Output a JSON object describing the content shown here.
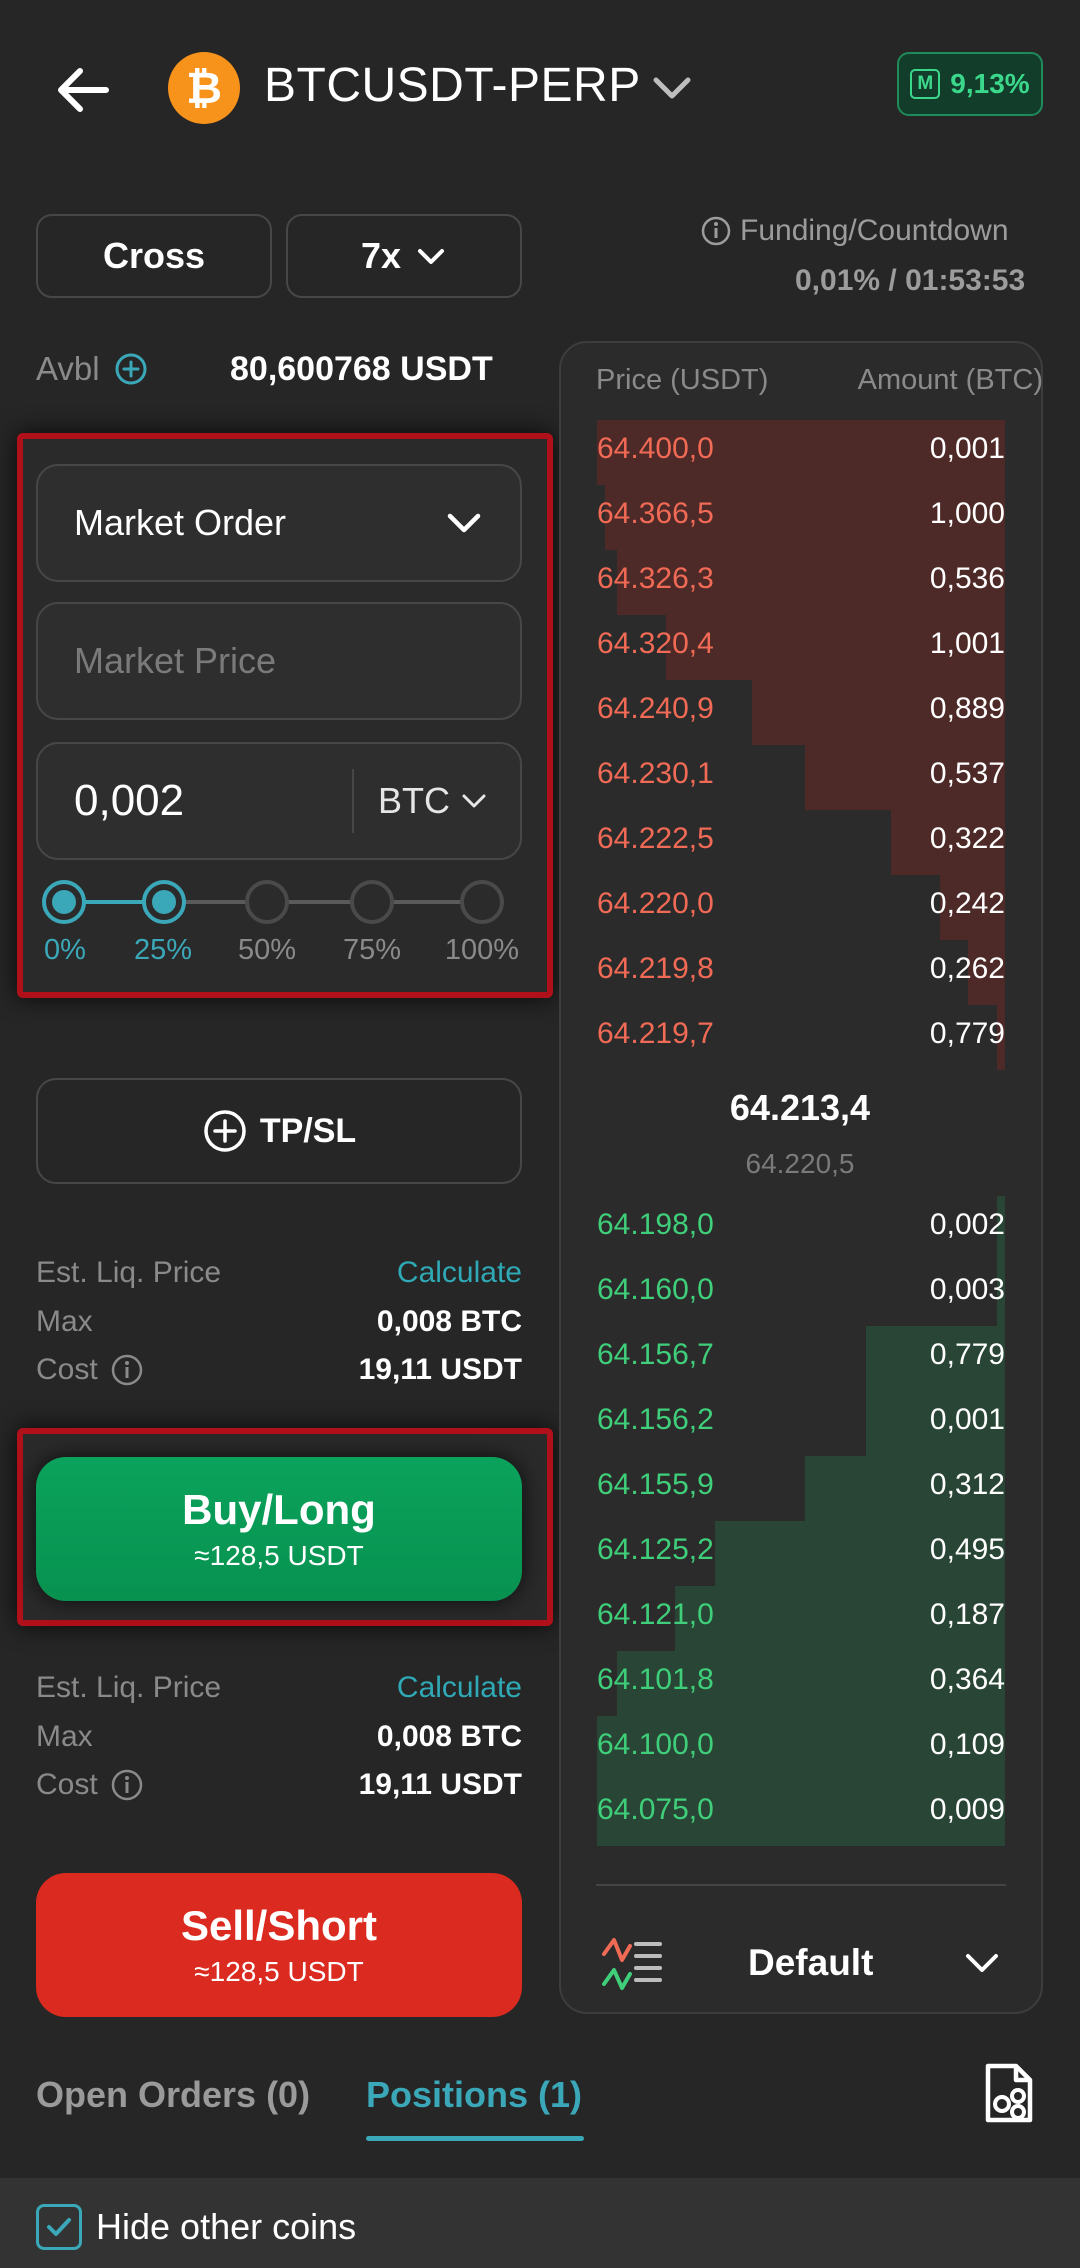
{
  "header": {
    "pair": "BTCUSDT-PERP",
    "coin_icon": "bitcoin-icon",
    "margin_badge_letter": "M",
    "margin_ratio": "9,13%",
    "colors": {
      "badge_green": "#3bd88c",
      "accent": "#3aa8b8"
    }
  },
  "controls": {
    "margin_mode": "Cross",
    "leverage": "7x",
    "funding_label": "Funding/Countdown",
    "funding_value": "0,01% / 01:53:53"
  },
  "balance": {
    "label": "Avbl",
    "value": "80,600768 USDT"
  },
  "order_form": {
    "order_type": "Market Order",
    "price_placeholder": "Market Price",
    "quantity": "0,002",
    "quantity_unit": "BTC",
    "slider": {
      "value_percent": 25,
      "marks": [
        "0%",
        "25%",
        "50%",
        "75%",
        "100%"
      ]
    },
    "tpsl_label": "TP/SL"
  },
  "buy_info": {
    "liq_label": "Est. Liq. Price",
    "liq_action": "Calculate",
    "max_label": "Max",
    "max_value": "0,008 BTC",
    "cost_label": "Cost",
    "cost_value": "19,11 USDT"
  },
  "buy_button": {
    "label": "Buy/Long",
    "sub": "≈128,5 USDT",
    "color": "#0aa35c"
  },
  "sell_info": {
    "liq_label": "Est. Liq. Price",
    "liq_action": "Calculate",
    "max_label": "Max",
    "max_value": "0,008 BTC",
    "cost_label": "Cost",
    "cost_value": "19,11 USDT"
  },
  "sell_button": {
    "label": "Sell/Short",
    "sub": "≈128,5 USDT",
    "color": "#db2a1f"
  },
  "order_book": {
    "price_header": "Price (USDT)",
    "amount_header": "Amount (BTC)",
    "asks": [
      {
        "price": "64.400,0",
        "amount": "0,001",
        "depth": 1.0
      },
      {
        "price": "64.366,5",
        "amount": "1,000",
        "depth": 0.98
      },
      {
        "price": "64.326,3",
        "amount": "0,536",
        "depth": 0.95
      },
      {
        "price": "64.320,4",
        "amount": "1,001",
        "depth": 0.83
      },
      {
        "price": "64.240,9",
        "amount": "0,889",
        "depth": 0.62
      },
      {
        "price": "64.230,1",
        "amount": "0,537",
        "depth": 0.49
      },
      {
        "price": "64.222,5",
        "amount": "0,322",
        "depth": 0.28
      },
      {
        "price": "64.220,0",
        "amount": "0,242",
        "depth": 0.16
      },
      {
        "price": "64.219,8",
        "amount": "0,262",
        "depth": 0.09
      },
      {
        "price": "64.219,7",
        "amount": "0,779",
        "depth": 0.02
      }
    ],
    "mid_price": "64.213,4",
    "mark_price": "64.220,5",
    "bids": [
      {
        "price": "64.198,0",
        "amount": "0,002",
        "depth": 0.02
      },
      {
        "price": "64.160,0",
        "amount": "0,003",
        "depth": 0.02
      },
      {
        "price": "64.156,7",
        "amount": "0,779",
        "depth": 0.34
      },
      {
        "price": "64.156,2",
        "amount": "0,001",
        "depth": 0.34
      },
      {
        "price": "64.155,9",
        "amount": "0,312",
        "depth": 0.49
      },
      {
        "price": "64.125,2",
        "amount": "0,495",
        "depth": 0.71
      },
      {
        "price": "64.121,0",
        "amount": "0,187",
        "depth": 0.81
      },
      {
        "price": "64.101,8",
        "amount": "0,364",
        "depth": 0.95
      },
      {
        "price": "64.100,0",
        "amount": "0,109",
        "depth": 1.0
      },
      {
        "price": "64.075,0",
        "amount": "0,009",
        "depth": 1.0
      }
    ],
    "depth_mode": "Default"
  },
  "tabs": [
    {
      "label": "Open Orders (0)"
    },
    {
      "label": "Positions (1)"
    }
  ],
  "footer": {
    "hide_other_coins": "Hide other coins",
    "checked": true
  }
}
